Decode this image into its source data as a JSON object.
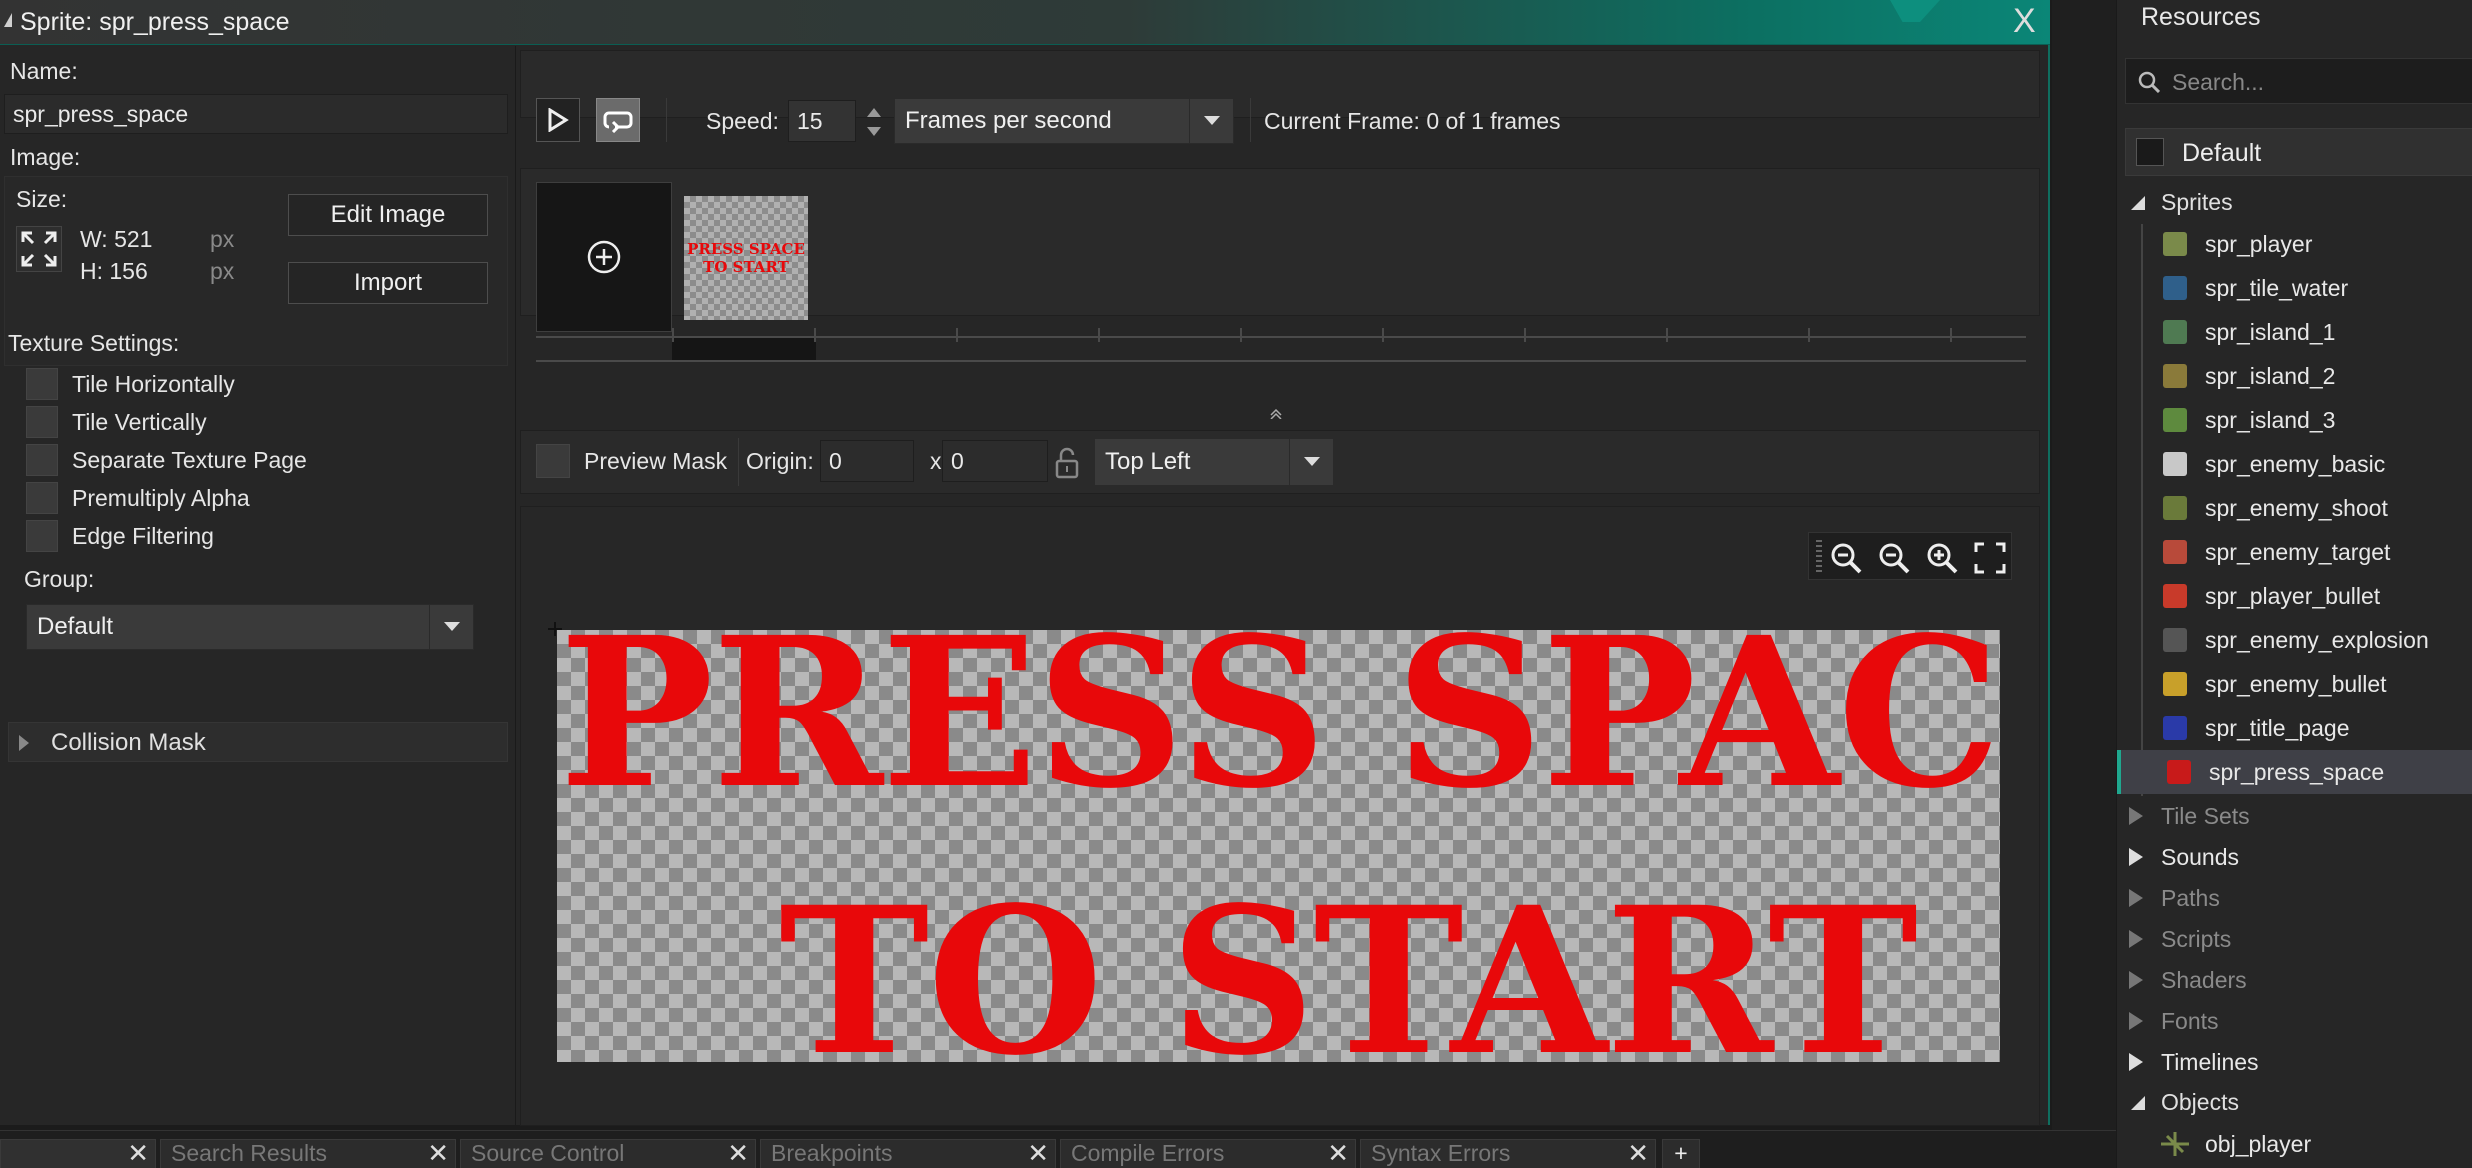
{
  "window": {
    "title": "Sprite: spr_press_space",
    "close": "X"
  },
  "left": {
    "name_label": "Name:",
    "name_value": "spr_press_space",
    "image_label": "Image:",
    "size_label": "Size:",
    "width": "W: 521",
    "height": "H: 156",
    "unit": "px",
    "edit_image": "Edit Image",
    "import": "Import",
    "texture_label": "Texture Settings:",
    "texture_options": [
      "Tile Horizontally",
      "Tile Vertically",
      "Separate Texture Page",
      "Premultiply Alpha",
      "Edge Filtering"
    ],
    "group_label": "Group:",
    "group_value": "Default",
    "collision_mask": "Collision Mask"
  },
  "anim": {
    "speed_label": "Speed:",
    "speed_value": "15",
    "speed_unit": "Frames per second",
    "current_frame": "Current Frame: 0 of 1 frames"
  },
  "frame_thumb_text": [
    "PRESS SPACE",
    "TO START"
  ],
  "origin": {
    "preview_mask": "Preview Mask",
    "origin_label": "Origin:",
    "x": "0",
    "sep": "x",
    "y": "0",
    "preset": "Top Left"
  },
  "canvas_text": {
    "line1": "PRESS SPACE",
    "line2": "TO START"
  },
  "resources": {
    "title": "Resources",
    "search_placeholder": "Search...",
    "filter": "Default",
    "sprites_label": "Sprites",
    "sprites": [
      {
        "name": "spr_player",
        "color": "#7a8a4a"
      },
      {
        "name": "spr_tile_water",
        "color": "#2f5f8a"
      },
      {
        "name": "spr_island_1",
        "color": "#4f7a52"
      },
      {
        "name": "spr_island_2",
        "color": "#8a7a3a"
      },
      {
        "name": "spr_island_3",
        "color": "#5e8a3e"
      },
      {
        "name": "spr_enemy_basic",
        "color": "#c8c8c8"
      },
      {
        "name": "spr_enemy_shoot",
        "color": "#6a7a3a"
      },
      {
        "name": "spr_enemy_target",
        "color": "#b84a3a"
      },
      {
        "name": "spr_player_bullet",
        "color": "#c83a2a"
      },
      {
        "name": "spr_enemy_explosion",
        "color": "#555555"
      },
      {
        "name": "spr_enemy_bullet",
        "color": "#c8a02a"
      },
      {
        "name": "spr_title_page",
        "color": "#2a3aa8"
      },
      {
        "name": "spr_press_space",
        "color": "#c81a1a"
      }
    ],
    "categories": [
      {
        "name": "Tile Sets",
        "dim": true
      },
      {
        "name": "Sounds",
        "dim": false
      },
      {
        "name": "Paths",
        "dim": true
      },
      {
        "name": "Scripts",
        "dim": true
      },
      {
        "name": "Shaders",
        "dim": true
      },
      {
        "name": "Fonts",
        "dim": true
      },
      {
        "name": "Timelines",
        "dim": false
      }
    ],
    "objects_label": "Objects",
    "objects": [
      "obj_player"
    ]
  },
  "bottom_tabs": [
    "",
    "Search Results",
    "Source Control",
    "Breakpoints",
    "Compile Errors",
    "Syntax Errors"
  ]
}
